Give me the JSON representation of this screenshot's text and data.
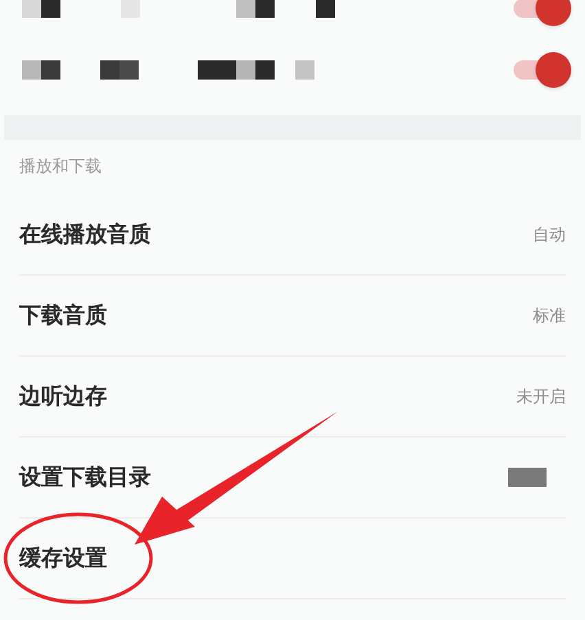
{
  "toggles": [
    {
      "on": true
    },
    {
      "on": true
    }
  ],
  "section": {
    "title": "播放和下载",
    "items": [
      {
        "label": "在线播放音质",
        "kind": "text",
        "value": "自动"
      },
      {
        "label": "下载音质",
        "kind": "text",
        "value": "标准"
      },
      {
        "label": "边听边存",
        "kind": "text",
        "value": "未开启"
      },
      {
        "label": "设置下载目录",
        "kind": "redacted"
      },
      {
        "label": "缓存设置",
        "kind": "none"
      }
    ]
  }
}
